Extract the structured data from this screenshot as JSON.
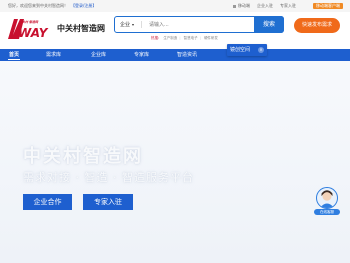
{
  "topbar": {
    "greeting": "您好，欢迎您来到中关村智造网！",
    "login_link": "【登录/注册】",
    "mobile": "移动端",
    "corp_entry": "企业入驻",
    "expert_entry": "专家入驻",
    "mobile_btn": "移动端客户端"
  },
  "logo": {
    "slogan": "中关村 智造网",
    "way": "WAY",
    "brand": "中关村智造网"
  },
  "search": {
    "scope": "企业",
    "placeholder": "请输入...",
    "button": "搜索"
  },
  "hot": {
    "label": "热搜:",
    "items": [
      "生产制造",
      "智慧电子",
      "硬件研发"
    ]
  },
  "publish_button": "快速发布需求",
  "nav": {
    "items": [
      {
        "label": "首页"
      },
      {
        "label": "需求库"
      },
      {
        "label": "企业库"
      },
      {
        "label": "专家库"
      },
      {
        "label": "智造资讯"
      }
    ]
  },
  "popup": {
    "label": "镜创空间",
    "close": "×"
  },
  "banner": {
    "title": "中关村智造网",
    "subtitle": "需求对接 · 智造 · 智造服务平台",
    "coop_button": "企业合作",
    "expert_button": "专家入驻"
  },
  "service": {
    "label": "在线客服"
  },
  "colors": {
    "primary": "#1e5fcf",
    "accent": "#f06a1a",
    "logo_red": "#c8102e"
  }
}
